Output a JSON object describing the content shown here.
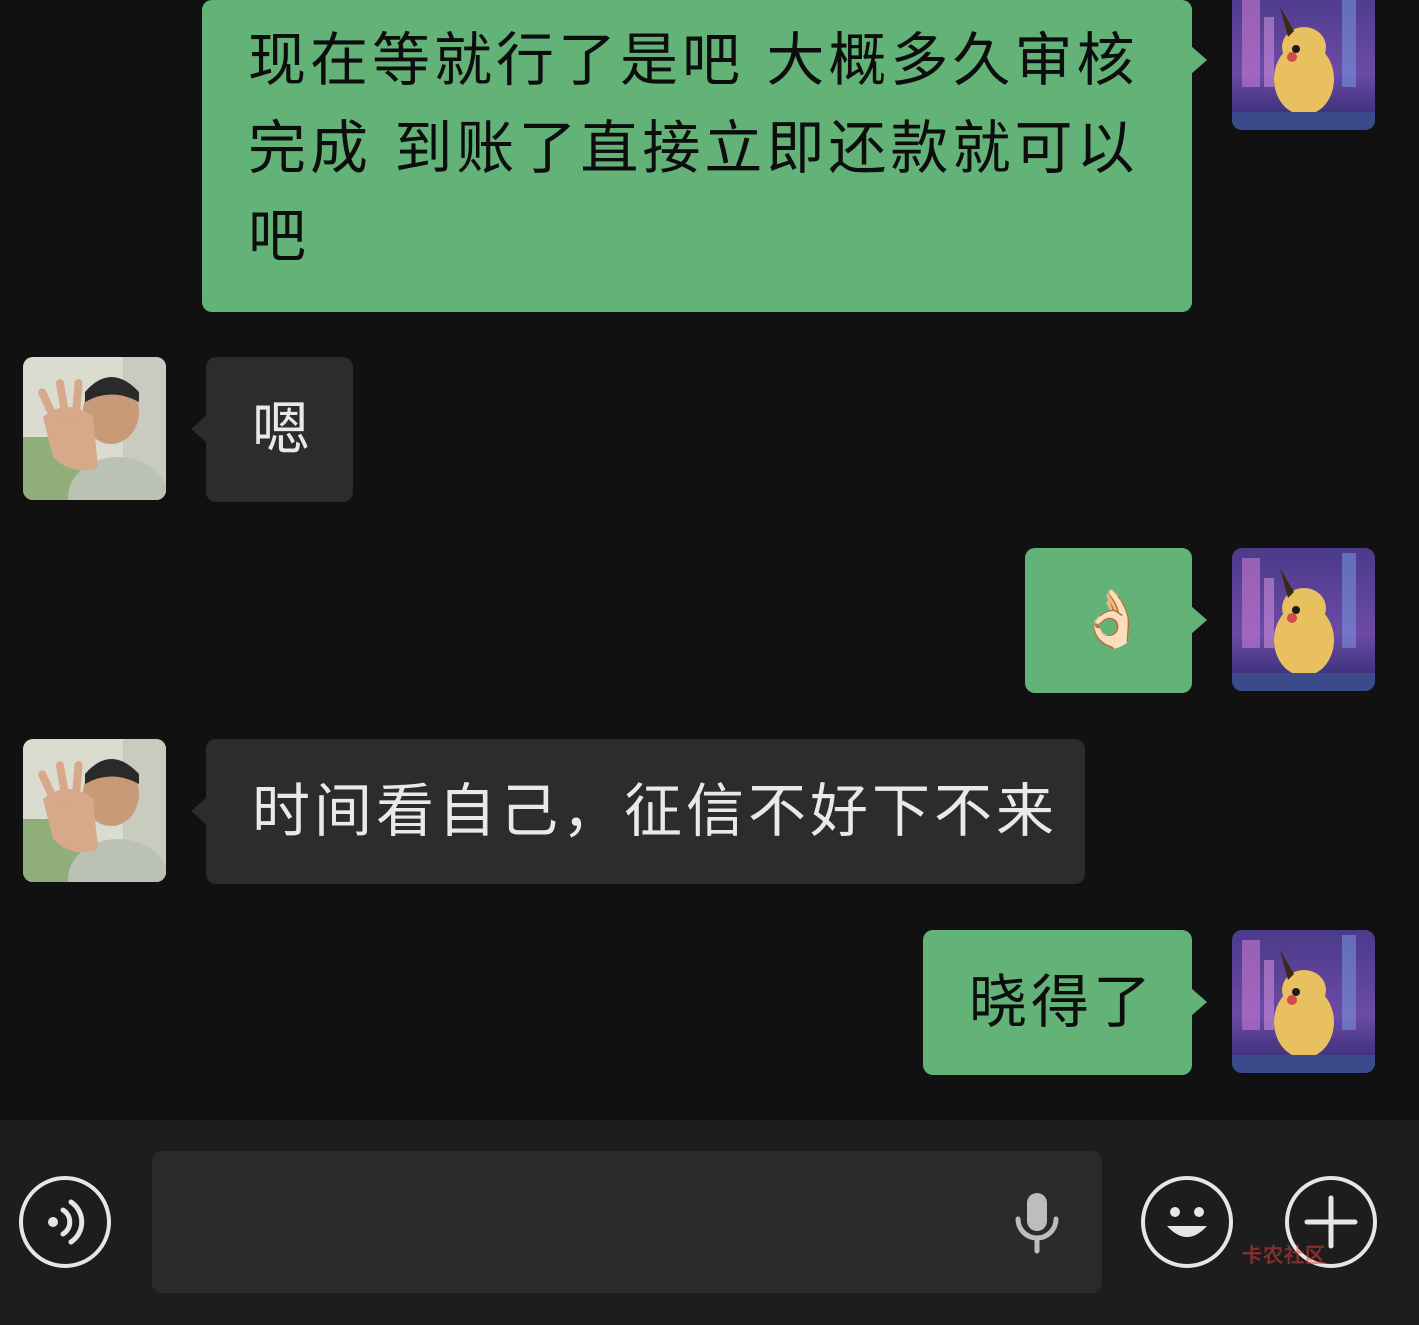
{
  "messages": [
    {
      "side": "sent",
      "text_lines": [
        "现在等就行了是吧  大概多久审核",
        "完成  到账了直接立即还款就可以",
        "吧"
      ]
    },
    {
      "side": "received",
      "text": "嗯"
    },
    {
      "side": "sent",
      "text": "👌🏻"
    },
    {
      "side": "received",
      "text": "时间看自己，征信不好下不来"
    },
    {
      "side": "sent",
      "text": "晓得了"
    }
  ],
  "input_bar": {
    "voice_toggle_icon": "voice-icon",
    "mic_icon": "microphone-icon",
    "emoji_icon": "emoji-icon",
    "plus_icon": "plus-icon",
    "text_value": ""
  },
  "watermark": {
    "text": "卡农社区"
  },
  "colors": {
    "sent_bubble": "#63b277",
    "received_bubble": "#2c2c2c",
    "background": "#111111"
  }
}
